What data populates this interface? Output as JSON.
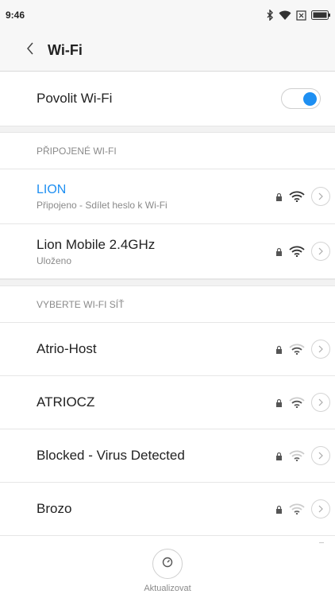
{
  "status_bar": {
    "time": "9:46",
    "icons": [
      "bluetooth-icon",
      "wifi-signal-icon",
      "no-sim-icon",
      "battery-icon"
    ]
  },
  "header": {
    "title": "Wi-Fi",
    "back_icon": "chevron-left-icon"
  },
  "wifi_toggle": {
    "label": "Povolit Wi-Fi",
    "enabled": true
  },
  "connected_section": {
    "header": "PŘIPOJENÉ WI-FI",
    "networks": [
      {
        "name": "LION",
        "subtitle": "Připojeno - Sdílet heslo k Wi-Fi",
        "locked": true,
        "signal": "strong",
        "active": true
      },
      {
        "name": "Lion Mobile 2.4GHz",
        "subtitle": "Uloženo",
        "locked": true,
        "signal": "strong",
        "active": false
      }
    ]
  },
  "available_section": {
    "header": "VYBERTE WI-FI SÍŤ",
    "networks": [
      {
        "name": "Atrio-Host",
        "locked": true,
        "signal": "medium"
      },
      {
        "name": "ATRIOCZ",
        "locked": true,
        "signal": "medium"
      },
      {
        "name": "Blocked - Virus Detected",
        "locked": true,
        "signal": "weak"
      },
      {
        "name": "Brozo",
        "locked": true,
        "signal": "weak"
      }
    ]
  },
  "refresh": {
    "label": "Aktualizovat",
    "icon": "refresh-icon"
  },
  "colors": {
    "accent": "#1e8ff2",
    "text": "#222222",
    "secondary_text": "#8a8a8a"
  }
}
